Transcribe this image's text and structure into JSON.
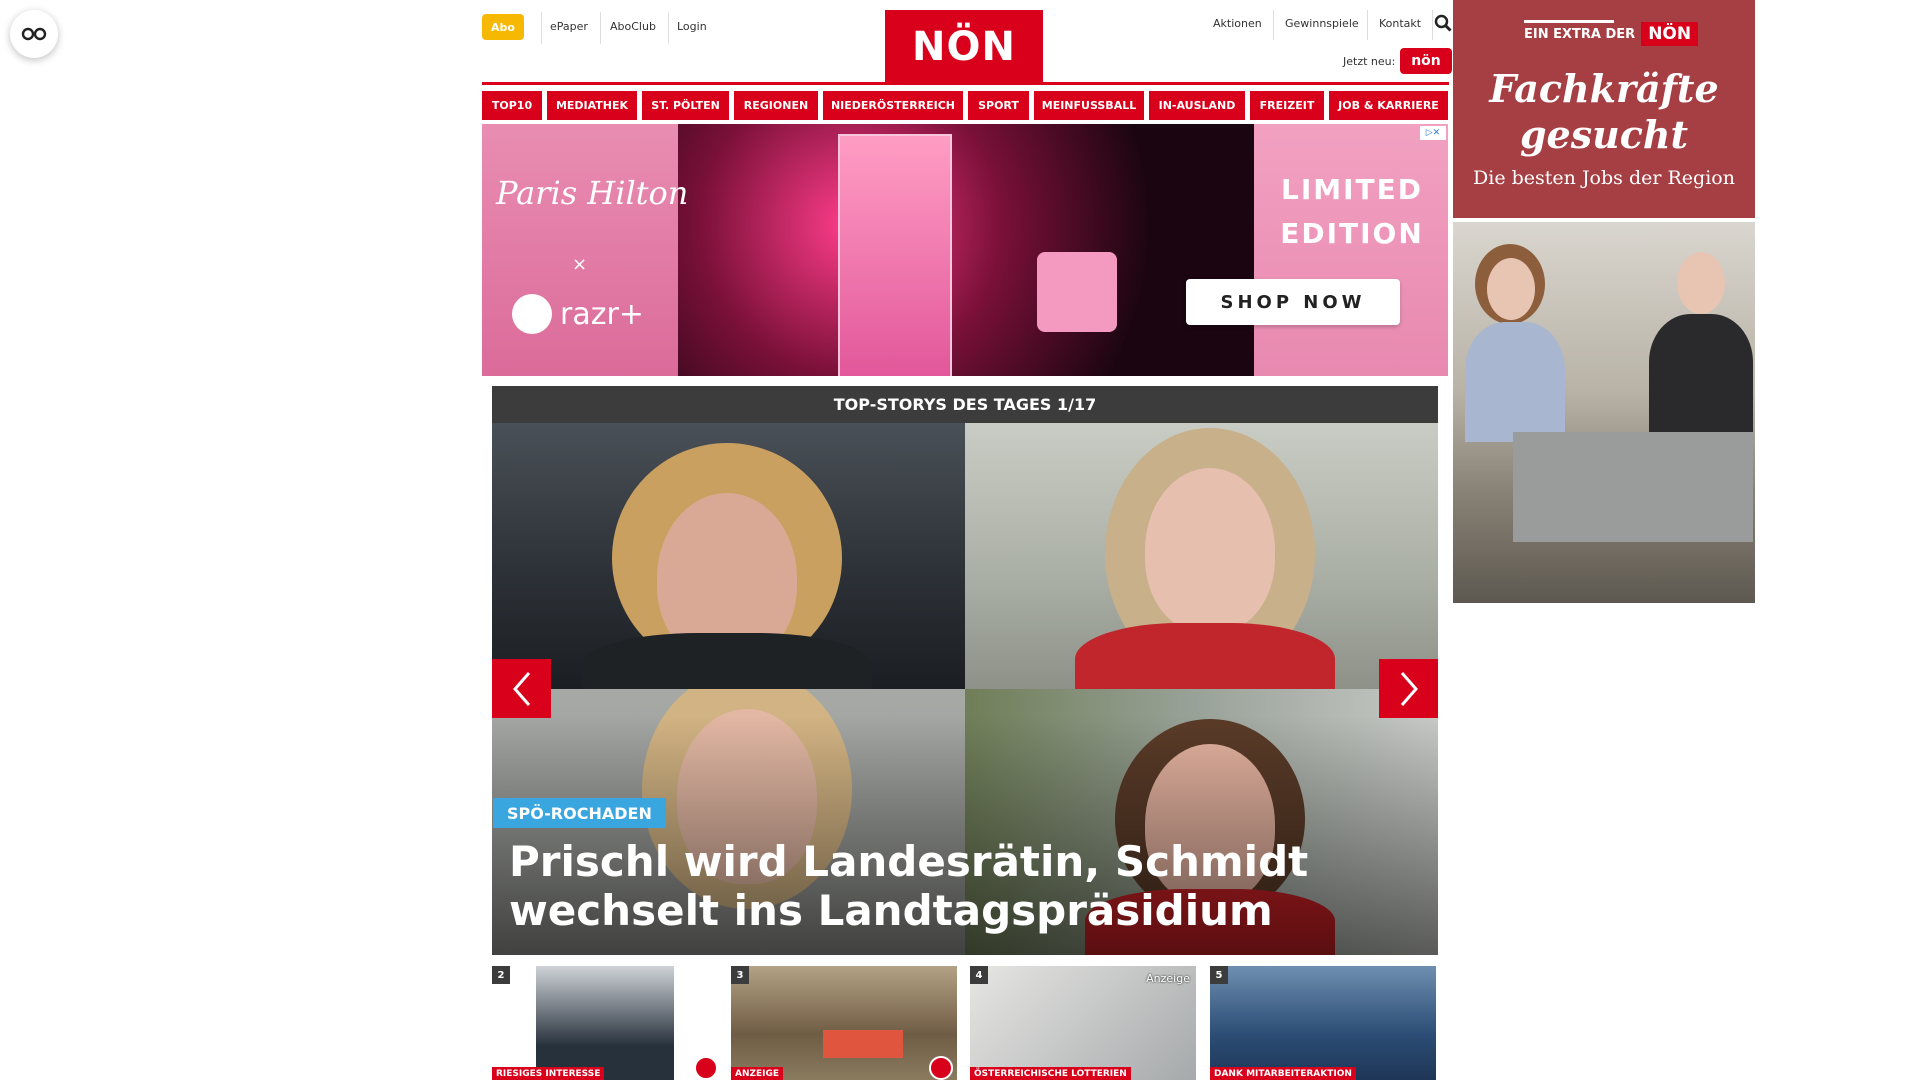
{
  "header": {
    "abo": "Abo",
    "links_left": [
      "ePaper",
      "AboClub",
      "Login"
    ],
    "logo": "NÖN",
    "links_right": [
      "Aktionen",
      "Gewinnspiele",
      "Kontakt"
    ],
    "jetzt_neu": "Jetzt neu:",
    "jetzt_neu_logo": "nön"
  },
  "nav": [
    "TOP10",
    "MEDIATHEK",
    "ST. PÖLTEN",
    "REGIONEN",
    "NIEDERÖSTERREICH",
    "SPORT",
    "MEINFUSSBALL",
    "IN-AUSLAND",
    "FREIZEIT",
    "JOB & KARRIERE"
  ],
  "ad_banner": {
    "brand": "Paris Hilton",
    "x": "×",
    "partner": "razr+",
    "limited": "LIMITED EDITION",
    "cta": "SHOP NOW"
  },
  "top_stories": {
    "header": "TOP-STORYS DES TAGES 1/17",
    "kicker": "SPÖ-ROCHADEN",
    "headline": "Prischl wird Landesrätin, Schmidt wechselt ins Landtagspräsidium"
  },
  "thumbnails": [
    {
      "num": "2",
      "tag": "RIESIGES INTERESSE"
    },
    {
      "num": "3",
      "tag": "ANZEIGE"
    },
    {
      "num": "4",
      "tag": "ÖSTERREICHISCHE LOTTERIEN",
      "label": "Anzeige"
    },
    {
      "num": "5",
      "tag": "DANK MITARBEITERAKTION"
    }
  ],
  "side_ad": {
    "extra": "EIN EXTRA DER",
    "logo": "NÖN",
    "title_line1": "Fachkräfte",
    "title_line2": "gesucht",
    "subtitle": "Die besten Jobs der Region"
  }
}
